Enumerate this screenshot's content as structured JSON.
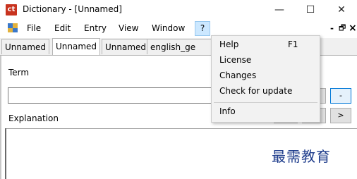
{
  "window": {
    "title": "Dictionary - [Unnamed]",
    "app_icon_text": "ct",
    "minimize_glyph": "—",
    "maximize_glyph": "☐",
    "close_glyph": "✕"
  },
  "menubar": {
    "items": [
      "File",
      "Edit",
      "Entry",
      "View",
      "Window",
      "?"
    ],
    "mdi_minimize_glyph": "-",
    "mdi_restore_glyph": "🗗",
    "mdi_close_glyph": "×"
  },
  "tabs": [
    {
      "label": "Unnamed",
      "active": false
    },
    {
      "label": "Unnamed",
      "active": true
    },
    {
      "label": "Unnamed",
      "active": false
    },
    {
      "label": "english_ge",
      "active": false
    }
  ],
  "term": {
    "label": "Term",
    "value": "",
    "minus_label": "-"
  },
  "explanation": {
    "label": "Explanation",
    "next_label": ">"
  },
  "help_menu": {
    "items": [
      {
        "label": "Help",
        "shortcut": "F1"
      },
      {
        "label": "License",
        "shortcut": ""
      },
      {
        "label": "Changes",
        "shortcut": ""
      },
      {
        "label": "Check for update",
        "shortcut": ""
      },
      {
        "label": "Info",
        "shortcut": ""
      }
    ]
  },
  "watermark": "最需教育"
}
